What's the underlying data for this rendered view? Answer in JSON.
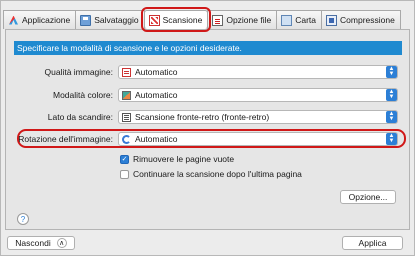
{
  "tabs": [
    {
      "label": "Applicazione",
      "icon": "application-icon"
    },
    {
      "label": "Salvataggio",
      "icon": "save-icon"
    },
    {
      "label": "Scansione",
      "icon": "scan-icon"
    },
    {
      "label": "Opzione file",
      "icon": "file-option-icon"
    },
    {
      "label": "Carta",
      "icon": "paper-icon"
    },
    {
      "label": "Compressione",
      "icon": "compression-icon"
    }
  ],
  "active_tab": "Scansione",
  "banner": "Specificare la modalità di scansione e le opzioni desiderate.",
  "settings": {
    "quality": {
      "label": "Qualità immagine:",
      "value": "Automatico"
    },
    "color_mode": {
      "label": "Modalità colore:",
      "value": "Automatico"
    },
    "scan_side": {
      "label": "Lato da scandire:",
      "value": "Scansione fronte-retro (fronte-retro)"
    },
    "rotation": {
      "label": "Rotazione dell'immagine:",
      "value": "Automatico"
    }
  },
  "checkboxes": {
    "remove_blank": {
      "label": "Rimuovere le pagine vuote",
      "checked": true
    },
    "continue_scan": {
      "label": "Continuare la scansione dopo l'ultima pagina",
      "checked": false
    }
  },
  "buttons": {
    "option": "Opzione...",
    "help": "?",
    "hide": "Nascondi",
    "apply": "Applica"
  },
  "colors": {
    "accent": "#2c7fd6",
    "banner": "#1f8ad0",
    "highlight": "#d01818"
  }
}
